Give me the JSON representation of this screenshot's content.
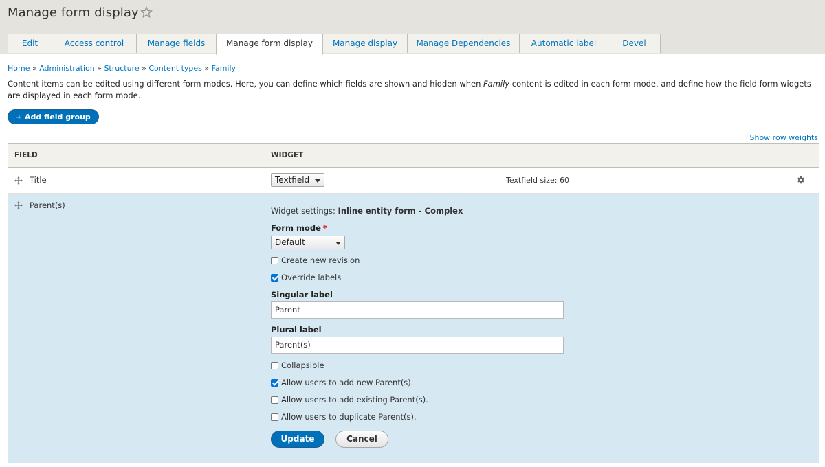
{
  "header": {
    "title": "Manage form display",
    "tabs": [
      {
        "label": "Edit"
      },
      {
        "label": "Access control"
      },
      {
        "label": "Manage fields"
      },
      {
        "label": "Manage form display",
        "active": true
      },
      {
        "label": "Manage display"
      },
      {
        "label": "Manage Dependencies"
      },
      {
        "label": "Automatic label"
      },
      {
        "label": "Devel"
      }
    ]
  },
  "breadcrumb": [
    "Home",
    "Administration",
    "Structure",
    "Content types",
    "Family"
  ],
  "description": {
    "before": "Content items can be edited using different form modes. Here, you can define which fields are shown and hidden when ",
    "emph": "Family",
    "after": " content is edited in each form mode, and define how the field form widgets are displayed in each form mode."
  },
  "actions": {
    "add_field_group": "+ Add field group",
    "show_row_weights": "Show row weights"
  },
  "table": {
    "col_field": "FIELD",
    "col_widget": "WIDGET",
    "title_row": {
      "field": "Title",
      "widget": "Textfield",
      "summary": "Textfield size: 60"
    },
    "parent_row": {
      "field": "Parent(s)",
      "widget_settings_prefix": "Widget settings:",
      "widget_settings_name": "Inline entity form - Complex",
      "form_mode_label": "Form mode",
      "form_mode_required": "*",
      "form_mode_value": "Default",
      "create_new_revision": "Create new revision",
      "override_labels": "Override labels",
      "singular_label_label": "Singular label",
      "singular_label_value": "Parent",
      "plural_label_label": "Plural label",
      "plural_label_value": "Parent(s)",
      "collapsible": "Collapsible",
      "allow_add_new": "Allow users to add new Parent(s).",
      "allow_add_existing": "Allow users to add existing Parent(s).",
      "allow_duplicate": "Allow users to duplicate Parent(s).",
      "update": "Update",
      "cancel": "Cancel",
      "checks": {
        "create_new_revision": false,
        "override_labels": true,
        "collapsible": false,
        "allow_add_new": true,
        "allow_add_existing": false,
        "allow_duplicate": false
      }
    }
  },
  "colors": {
    "link": "#0074bd",
    "primary_button": "#0071b8",
    "header_bg": "#e4e3de",
    "selected_row_bg": "#d6e8f2"
  }
}
